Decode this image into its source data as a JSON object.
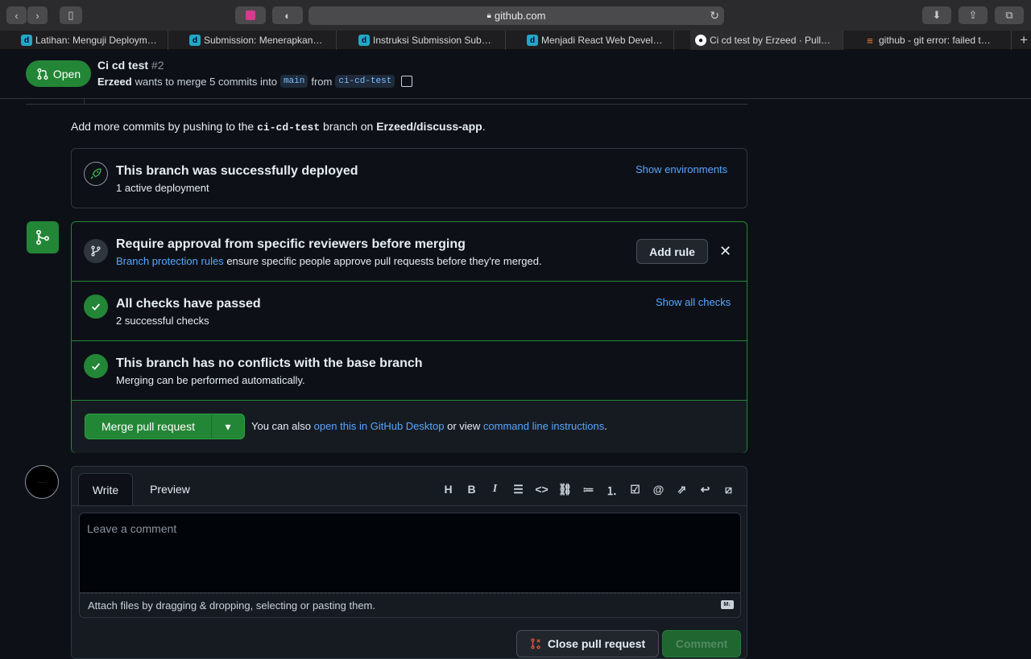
{
  "browser": {
    "url": "github.com",
    "tabs": [
      {
        "label": "Latihan: Menguji Deploym…",
        "icon": "dicoding-icon"
      },
      {
        "label": "Submission: Menerapkan…",
        "icon": "dicoding-icon"
      },
      {
        "label": "Instruksi Submission Sub…",
        "icon": "dicoding-icon"
      },
      {
        "label": "Menjadi React Web Devel…",
        "icon": "dicoding-icon"
      },
      {
        "label": "Ci cd test by Erzeed · Pull…",
        "icon": "github-icon"
      },
      {
        "label": "github - git error: failed t…",
        "icon": "stackoverflow-icon"
      }
    ]
  },
  "header": {
    "state": "Open",
    "title": "Ci cd test",
    "number": "#2",
    "author": "Erzeed",
    "merge_text": "wants to merge 5 commits into",
    "base": "main",
    "from_text": "from",
    "head": "ci-cd-test"
  },
  "hint": {
    "prefix": "Add more commits by pushing to the",
    "branch": "ci-cd-test",
    "middle": "branch on",
    "repo": "Erzeed/discuss-app",
    "suffix": "."
  },
  "deploy": {
    "title": "This branch was successfully deployed",
    "subtitle": "1 active deployment",
    "link": "Show environments"
  },
  "protection": {
    "title": "Require approval from specific reviewers before merging",
    "link": "Branch protection rules",
    "text": "ensure specific people approve pull requests before they're merged.",
    "button": "Add rule",
    "close": "✕"
  },
  "checks": {
    "title": "All checks have passed",
    "subtitle": "2 successful checks",
    "link": "Show all checks"
  },
  "conflicts": {
    "title": "This branch has no conflicts with the base branch",
    "subtitle": "Merging can be performed automatically."
  },
  "merge": {
    "button": "Merge pull request",
    "also_prefix": "You can also",
    "desktop_link": "open this in GitHub Desktop",
    "or_view": "or view",
    "cli_link": "command line instructions",
    "suffix": "."
  },
  "comment": {
    "tab_write": "Write",
    "tab_preview": "Preview",
    "placeholder": "Leave a comment",
    "attach": "Attach files by dragging & dropping, selecting or pasting them.",
    "close_button": "Close pull request",
    "comment_button": "Comment",
    "tools": [
      "H",
      "B",
      "I",
      "quote",
      "code",
      "link",
      "ul",
      "ol",
      "task",
      "@",
      "ref",
      "reply",
      "slash"
    ]
  },
  "colors": {
    "accent_green": "#238636",
    "link_blue": "#58a6ff",
    "bg": "#0d1117"
  }
}
